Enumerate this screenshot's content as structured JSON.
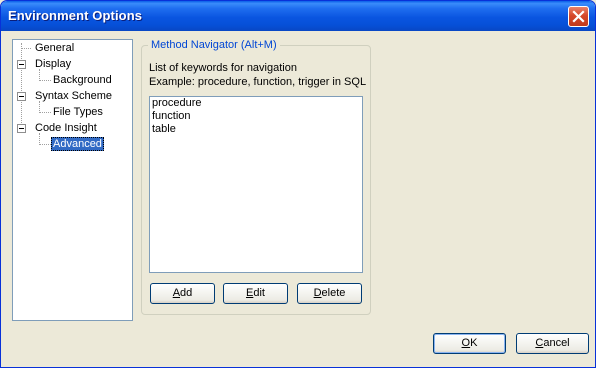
{
  "window": {
    "title": "Environment Options"
  },
  "tree": {
    "items": [
      {
        "label": "General",
        "level": 0
      },
      {
        "label": "Display",
        "level": 0
      },
      {
        "label": "Background",
        "level": 1
      },
      {
        "label": "Syntax Scheme",
        "level": 0
      },
      {
        "label": "File Types",
        "level": 1
      },
      {
        "label": "Code Insight",
        "level": 0
      },
      {
        "label": "Advanced",
        "level": 1,
        "selected": true
      }
    ]
  },
  "method_navigator": {
    "group_title": "Method Navigator (Alt+M)",
    "description_line1": "List of keywords for navigation",
    "description_line2": "Example: procedure, function, trigger in SQL",
    "keywords": [
      "procedure",
      "function",
      "table"
    ],
    "add_button": {
      "mnemonic": "A",
      "rest": "dd"
    },
    "edit_button": {
      "mnemonic": "E",
      "rest": "dit"
    },
    "delete_button": {
      "mnemonic": "D",
      "rest": "elete"
    }
  },
  "footer": {
    "ok_button": {
      "mnemonic": "O",
      "rest": "K"
    },
    "cancel_button": {
      "mnemonic": "C",
      "rest": "ancel"
    }
  },
  "colors": {
    "selection": "#316ac5",
    "group_title": "#0046d5",
    "titlebar": "#0a55e0"
  }
}
